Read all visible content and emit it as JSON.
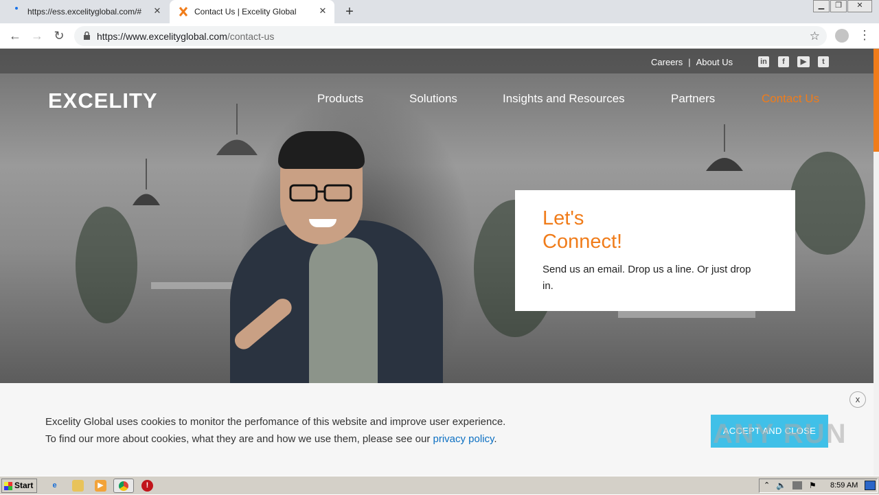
{
  "browser": {
    "tabs": [
      {
        "title": "https://ess.excelityglobal.com/#",
        "active": false
      },
      {
        "title": "Contact Us | Excelity Global",
        "active": true
      }
    ],
    "url_host": "https://www.excelityglobal.com",
    "url_path": "/contact-us"
  },
  "site": {
    "util_links": [
      "Careers",
      "About Us"
    ],
    "social_icons": [
      "linkedin-icon",
      "facebook-icon",
      "youtube-icon",
      "twitter-icon"
    ],
    "logo": "EXCELITY",
    "nav": [
      "Products",
      "Solutions",
      "Insights and Resources",
      "Partners",
      "Contact Us"
    ],
    "active_nav": "Contact Us",
    "accent_color": "#f07c1a"
  },
  "hero_card": {
    "title_line1": "Let's",
    "title_line2": "Connect!",
    "text": "Send us an email. Drop us a line. Or just drop in."
  },
  "cookie": {
    "line1": "Excelity Global uses cookies to monitor the perfomance of this website and improve user experience.",
    "line2_prefix": "To find our more about cookies, what they are and how we use them, please see our",
    "link": "privacy policy",
    "line2_suffix": ".",
    "accept": "ACCEPT AND CLOSE",
    "close": "x"
  },
  "watermark": "ANY RUN",
  "taskbar": {
    "start": "Start",
    "clock": "8:59 AM"
  }
}
